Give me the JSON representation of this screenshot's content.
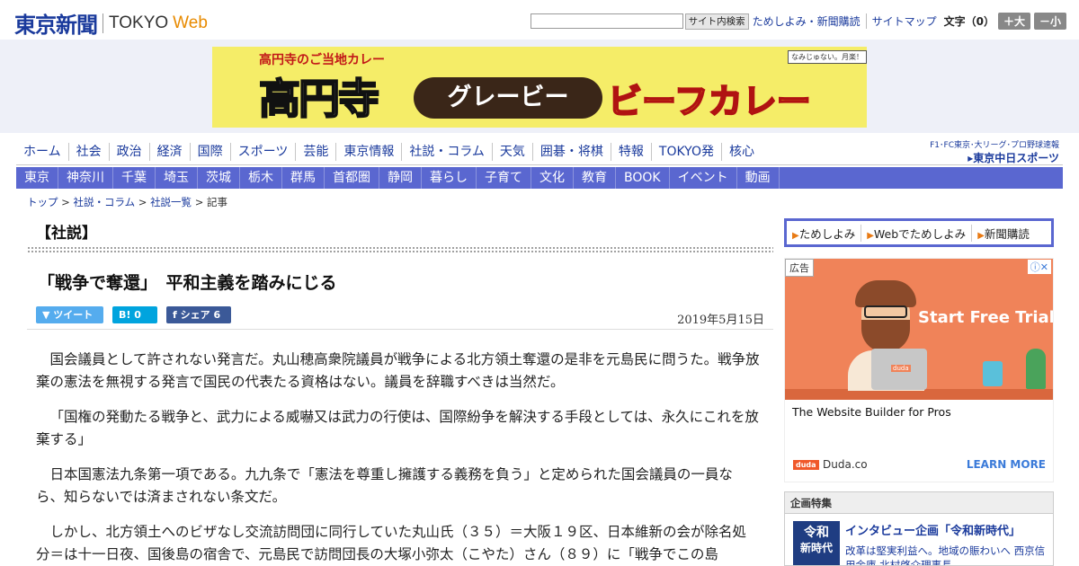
{
  "header": {
    "logo_jp": "東京新聞",
    "logo_en": "TOKYO",
    "logo_web": "Web",
    "search_button": "サイト内検索",
    "search_value": "",
    "links": [
      "ためしよみ・新聞購読",
      "サイトマップ"
    ],
    "font_size_label": "文字（0）",
    "font_bigger": "＋大",
    "font_smaller": "－小"
  },
  "banner": {
    "sub": "高円寺のご当地カレー",
    "big": "高円寺",
    "pill": "グレービー",
    "curry": "ビーフカレー",
    "tag": "なみじゅない。月楽！"
  },
  "global_nav": [
    "ホーム",
    "社会",
    "政治",
    "経済",
    "国際",
    "スポーツ",
    "芸能",
    "東京情報",
    "社説・コラム",
    "天気",
    "囲碁・将棋",
    "特報",
    "TOKYO発",
    "核心"
  ],
  "chunichi": {
    "line1": "F1･FC東京･大リーグ･プロ野球速報",
    "line2": "▸東京中日スポーツ"
  },
  "region_nav": [
    "東京",
    "神奈川",
    "千葉",
    "埼玉",
    "茨城",
    "栃木",
    "群馬",
    "首都圏",
    "静岡",
    "暮らし",
    "子育て",
    "文化",
    "教育",
    "BOOK",
    "イベント",
    "動画"
  ],
  "breadcrumb": {
    "items": [
      "トップ",
      "社説・コラム",
      "社説一覧"
    ],
    "current": "記事",
    "sep": " > "
  },
  "article": {
    "section": "【社説】",
    "headline": "「戦争で奪還」　平和主義を踏みにじる",
    "tweet": "ツイート",
    "hatena": "B! 0",
    "share": "シェア 6",
    "date": "2019年5月15日",
    "paragraphs": [
      "国会議員として許されない発言だ。丸山穂高衆院議員が戦争による北方領土奪還の是非を元島民に問うた。戦争放棄の憲法を無視する発言で国民の代表たる資格はない。議員を辞職すべきは当然だ。",
      "「国権の発動たる戦争と、武力による威嚇又は武力の行使は、国際紛争を解決する手段としては、永久にこれを放棄する」",
      "日本国憲法九条第一項である。九九条で「憲法を尊重し擁護する義務を負う」と定められた国会議員の一員なら、知らないでは済まされない条文だ。",
      "しかし、北方領土へのビザなし交流訪問団に同行していた丸山氏（３５）＝大阪１９区、日本維新の会が除名処分＝は十一日夜、国後島の宿舎で、元島民で訪問団長の大塚小弥太（こやた）さん（８９）に「戦争でこの島"
    ]
  },
  "sidebar": {
    "links": [
      "ためしよみ",
      "Webでためしよみ",
      "新聞購読"
    ],
    "ad": {
      "label": "広告",
      "close": "ⓘ✕",
      "headline": "Start Free Trial",
      "badge": "duda",
      "title": "The Website Builder for Pros",
      "brand_logo": "duda",
      "brand": "Duda.co",
      "cta": "LEARN MORE"
    },
    "kikaku": {
      "head": "企画特集",
      "thumb_line1": "令和",
      "thumb_line2": "新時代",
      "title": "インタビュー企画「令和新時代」",
      "text": "改革は堅実利益へ。地域の賑わいへ 西京信用金庫 北村啓介理事長"
    }
  }
}
